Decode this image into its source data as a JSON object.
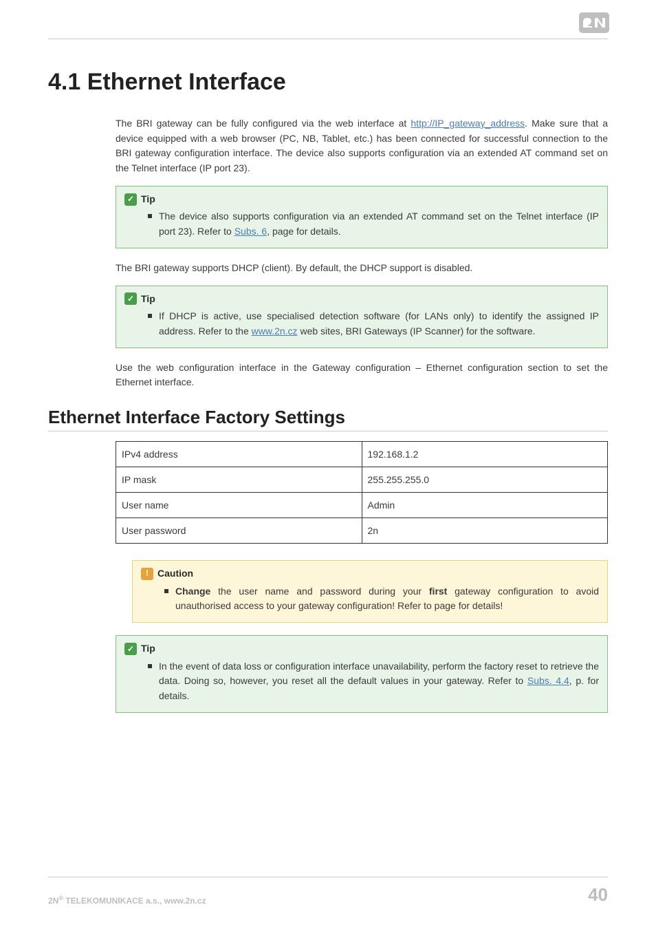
{
  "section_number": "4.1",
  "section_title": "Ethernet Interface",
  "h1_full": "4.1 Ethernet Interface",
  "para1_a": "The BRI gateway can be fully configured via the web interface at ",
  "para1_link": "http://IP_gateway_address",
  "para1_b": ". Make sure that a device equipped with a web browser (PC, NB, Tablet, etc.) has been connected for successful connection to the BRI gateway configuration interface. The device also supports configuration via an extended AT command set on the Telnet interface (IP port 23).",
  "tip_label": "Tip",
  "tip1_a": "The device also supports configuration via an extended AT command set on the Telnet interface (IP port 23). Refer to ",
  "tip1_link": "Subs. 6",
  "tip1_b": ", page for details.",
  "para2": "The BRI gateway supports DHCP (client). By default, the DHCP support is disabled.",
  "tip2_a": "If DHCP is active, use specialised detection software (for LANs only) to identify the assigned IP address. Refer to the ",
  "tip2_link": "www.2n.cz",
  "tip2_b": " web sites, BRI Gateways (IP Scanner) for the software.",
  "para3": "Use the web configuration interface in the Gateway configuration – Ethernet configuration section to set the Ethernet interface.",
  "h2": "Ethernet Interface Factory Settings",
  "table": [
    {
      "k": "IPv4 address",
      "v": "192.168.1.2"
    },
    {
      "k": "IP mask",
      "v": "255.255.255.0"
    },
    {
      "k": "User name",
      "v": "Admin"
    },
    {
      "k": "User password",
      "v": "2n"
    }
  ],
  "caution_label": "Caution",
  "caution_strong1": "Change",
  "caution_mid": " the user name and password during your ",
  "caution_strong2": "first",
  "caution_end": " gateway configuration to avoid unauthorised access to your gateway configuration! Refer to page for details!",
  "tip3_a": "In the event of data loss or configuration interface unavailability, perform the factory reset to retrieve the data. Doing so, however, you reset all the default values in your gateway. Refer to ",
  "tip3_link": "Subs. 4.4",
  "tip3_b": ", p. for details.",
  "footer_left_a": "2N",
  "footer_left_sup": "®",
  "footer_left_b": " TELEKOMUNIKACE a.s., www.2n.cz",
  "page_number": "40",
  "icons": {
    "tip": "✓",
    "caution": "!"
  }
}
